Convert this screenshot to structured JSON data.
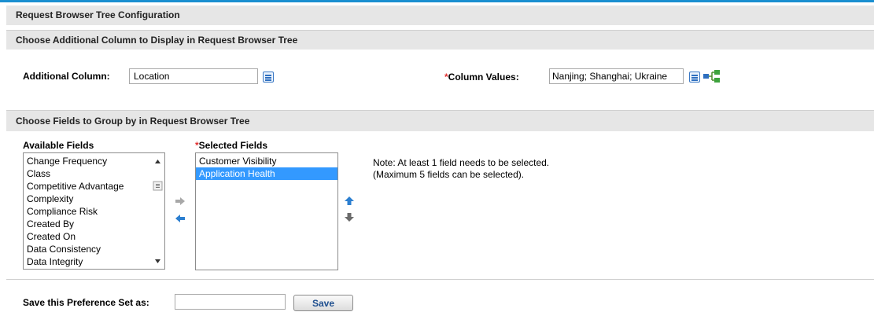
{
  "page_title": "Request Browser Tree Configuration",
  "section_columns": {
    "title": "Choose Additional Column to Display in Request Browser Tree",
    "additional_column_label": "Additional Column:",
    "additional_column_value": "Location",
    "column_values_label": "Column Values:",
    "column_values_value": "Nanjing; Shanghai; Ukraine"
  },
  "section_group": {
    "title": "Choose Fields to Group by in Request Browser Tree",
    "available_label": "Available Fields",
    "available_fields": [
      "Change Frequency",
      "Class",
      "Competitive Advantage",
      "Complexity",
      "Compliance Risk",
      "Created By",
      "Created On",
      "Data Consistency",
      "Data Integrity"
    ],
    "selected_label": "Selected Fields",
    "selected_fields": [
      "Customer Visibility",
      "Application Health"
    ],
    "selected_highlight": "Application Health",
    "note_line1": "Note: At least 1 field needs to be selected.",
    "note_line2": "(Maximum 5 fields can be selected)."
  },
  "save": {
    "label": "Save this Preference Set as:",
    "value": "",
    "button_label": "Save"
  },
  "colors": {
    "accent": "#1a8fd0",
    "header_bg": "#e6e6e6",
    "selection": "#3399ff",
    "required": "#e03030"
  }
}
